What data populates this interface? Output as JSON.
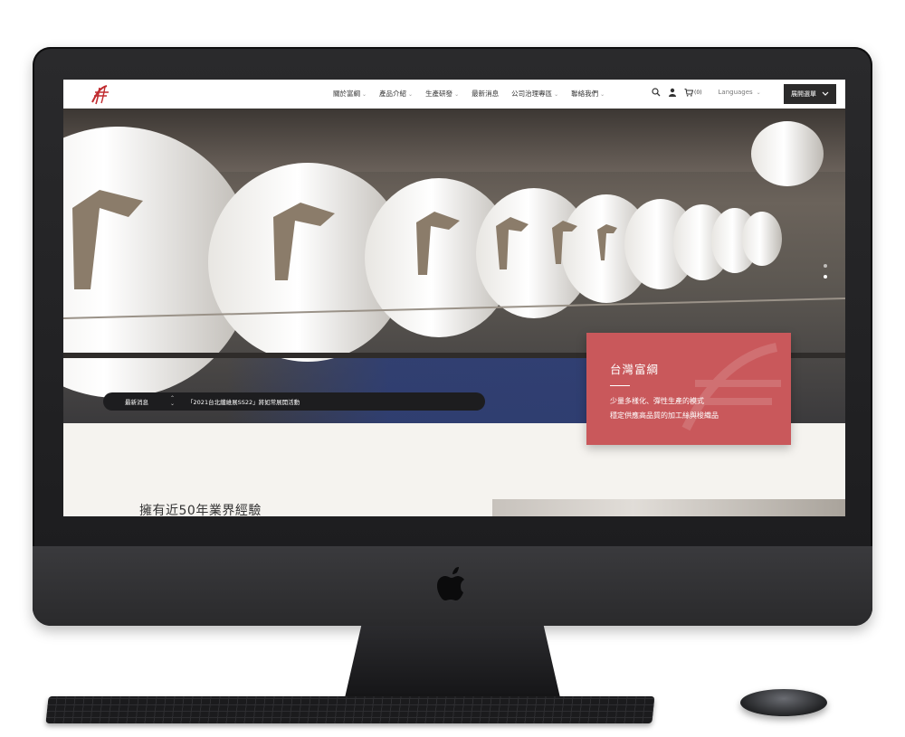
{
  "navbar": {
    "menu": [
      {
        "label": "關於富綱",
        "has_dropdown": true
      },
      {
        "label": "產品介紹",
        "has_dropdown": true
      },
      {
        "label": "生產研發",
        "has_dropdown": true
      },
      {
        "label": "最新消息",
        "has_dropdown": false
      },
      {
        "label": "公司治理專區",
        "has_dropdown": true
      },
      {
        "label": "聯絡我們",
        "has_dropdown": true
      }
    ],
    "icons": [
      "search-icon",
      "user-icon",
      "cart-icon"
    ],
    "cart_count": "(0)",
    "languages_label": "Languages",
    "open_button_label": "展開選單"
  },
  "hero": {
    "news_label": "最新消息",
    "news_text": "「2021台北纖維展SS22」將如常展開活動",
    "slide_count": 2,
    "active_slide": 2
  },
  "intro_card": {
    "title": "台灣富綱",
    "line1": "少量多樣化、彈性生產的模式",
    "line2": "穩定供應高品質的加工絲與梭織品",
    "color": "#c9585b"
  },
  "section": {
    "heading": "擁有近50年業界經驗"
  },
  "colors": {
    "brand": "#c02a2e",
    "dark_button": "#2b2a2a",
    "page_bg": "#f5f3ef"
  }
}
